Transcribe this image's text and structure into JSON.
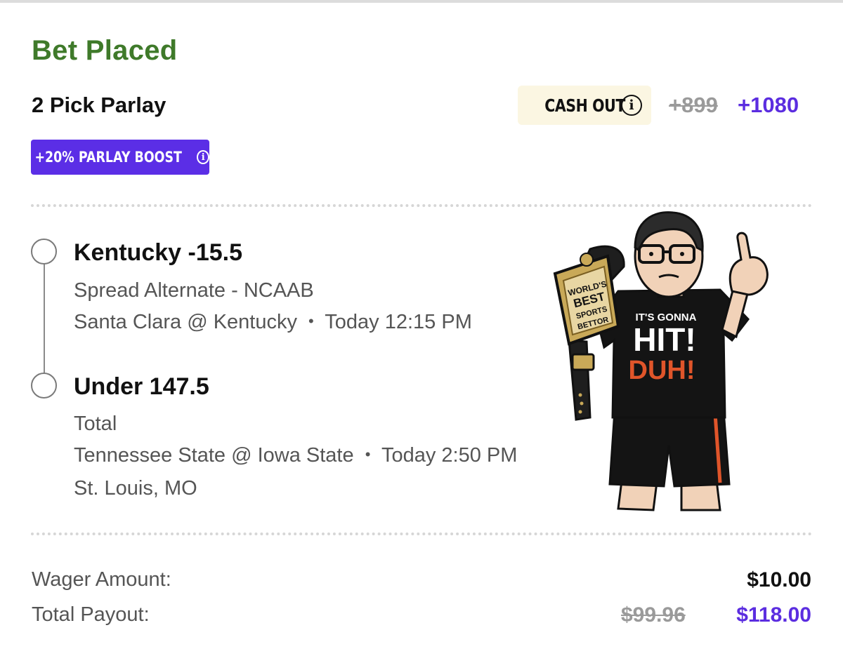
{
  "header": {
    "title": "Bet Placed",
    "subtitle": "2 Pick Parlay",
    "cashout_label": "CASH OUT",
    "info_glyph": "i",
    "odds_old": "+899",
    "odds_new": "+1080",
    "boost_label": "+20% PARLAY BOOST",
    "accent_color": "#5b2de0",
    "title_color": "#3f7a2a"
  },
  "picks": [
    {
      "title": "Kentucky -15.5",
      "market": "Spread Alternate - NCAAB",
      "game": "Santa Clara @ Kentucky",
      "separator": "•",
      "time": "Today 12:15 PM"
    },
    {
      "title": "Under 147.5",
      "market": "Total",
      "game": "Tennessee State @ Iowa State",
      "separator": "•",
      "time": "Today 2:50 PM",
      "location": "St. Louis, MO"
    }
  ],
  "mascot": {
    "belt_text": [
      "WORLD'S",
      "BEST",
      "SPORTS",
      "BETTOR"
    ],
    "shirt_text": [
      "IT'S GONNA",
      "HIT!",
      "DUH!"
    ]
  },
  "summary": {
    "wager_label": "Wager Amount:",
    "wager_value": "$10.00",
    "payout_label": "Total Payout:",
    "payout_old": "$99.96",
    "payout_new": "$118.00"
  }
}
